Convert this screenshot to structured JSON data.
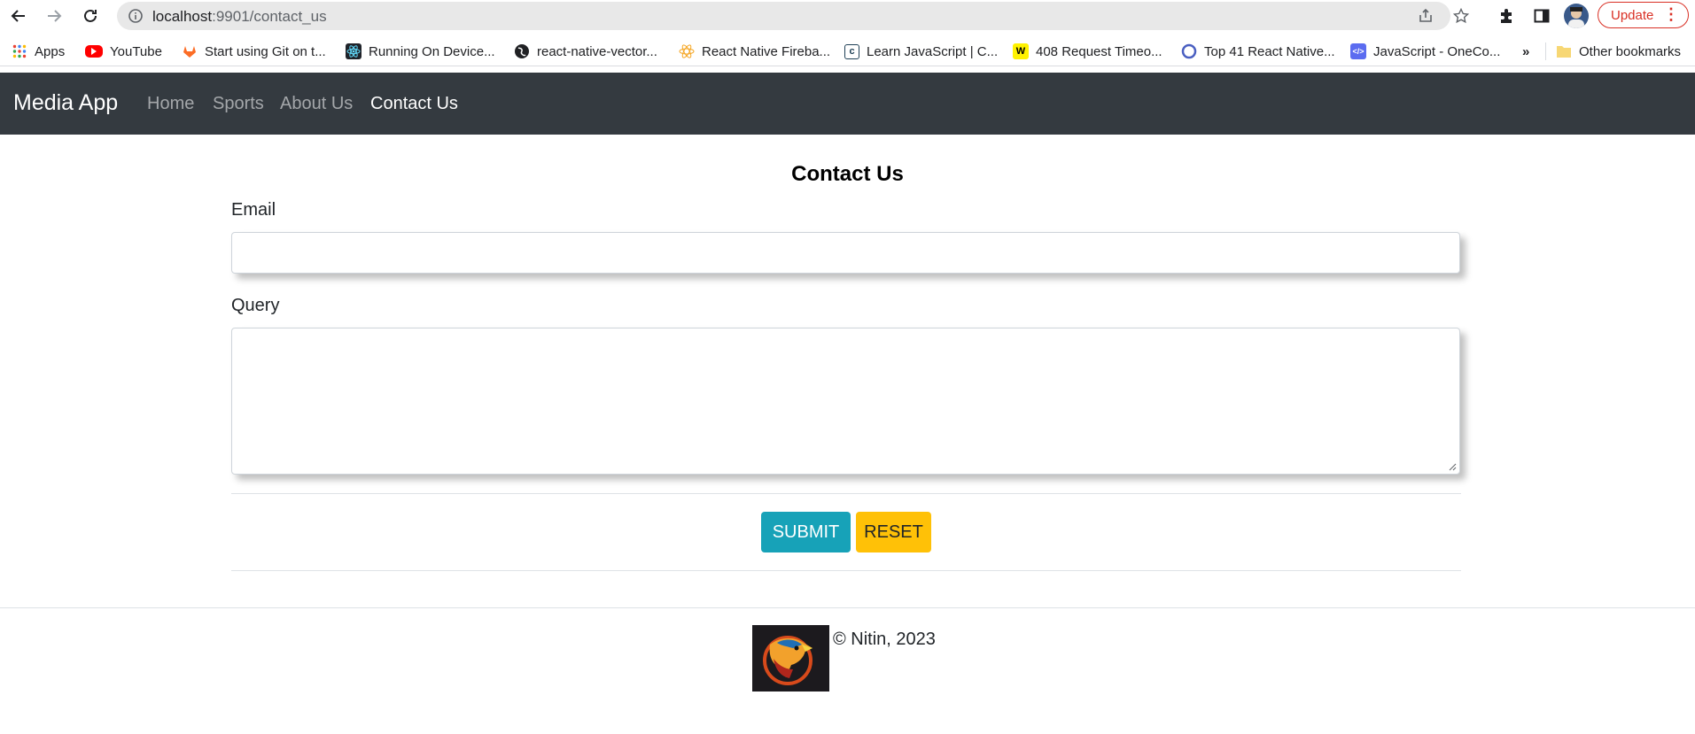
{
  "browser": {
    "url_host": "localhost",
    "url_path": ":9901/contact_us",
    "update_label": "Update",
    "bookmarks": [
      {
        "label": "Apps",
        "icon": "apps-grid-icon"
      },
      {
        "label": "YouTube",
        "icon": "youtube-icon"
      },
      {
        "label": "Start using Git on t...",
        "icon": "gitlab-icon"
      },
      {
        "label": "Running On Device...",
        "icon": "react-icon"
      },
      {
        "label": "react-native-vector...",
        "icon": "globe-icon"
      },
      {
        "label": "React Native Fireba...",
        "icon": "react-firebase-icon"
      },
      {
        "label": "Learn JavaScript | C...",
        "icon": "codecademy-icon"
      },
      {
        "label": "408 Request Timeo...",
        "icon": "w3-icon"
      },
      {
        "label": "Top 41 React Native...",
        "icon": "ring-icon"
      },
      {
        "label": "JavaScript - OneCo...",
        "icon": "code-icon"
      }
    ],
    "more_label": "»",
    "other_bookmarks": "Other bookmarks"
  },
  "navbar": {
    "brand": "Media App",
    "links": [
      "Home",
      "Sports",
      "About Us",
      "Contact Us"
    ],
    "active": "Contact Us"
  },
  "form": {
    "title": "Contact Us",
    "email_label": "Email",
    "email_value": "",
    "query_label": "Query",
    "query_value": "",
    "submit_label": "SUBMIT",
    "reset_label": "RESET"
  },
  "footer": {
    "copyright": "© Nitin, 2023"
  },
  "colors": {
    "navbar_bg": "#343a40",
    "submit_bg": "#17a2b8",
    "reset_bg": "#ffc107",
    "update_border": "#d93025"
  }
}
